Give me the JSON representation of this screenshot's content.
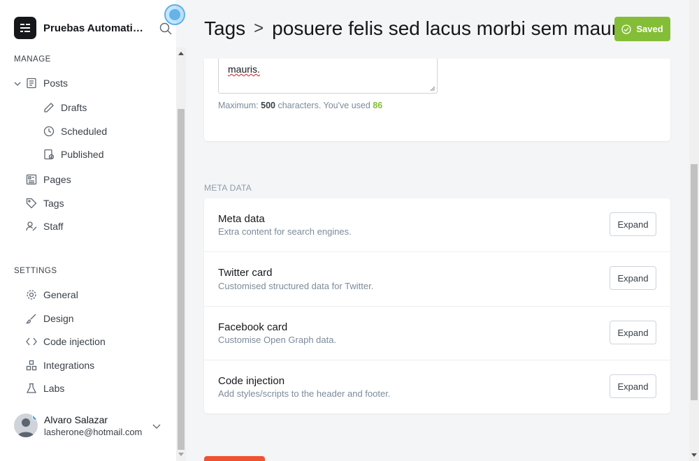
{
  "sidebar": {
    "brand_name": "Pruebas Automatizadas",
    "manage_title": "MANAGE",
    "settings_title": "SETTINGS",
    "items": {
      "posts": "Posts",
      "drafts": "Drafts",
      "scheduled": "Scheduled",
      "published": "Published",
      "pages": "Pages",
      "tags": "Tags",
      "staff": "Staff",
      "general": "General",
      "design": "Design",
      "code_injection": "Code injection",
      "integrations": "Integrations",
      "labs": "Labs"
    },
    "user": {
      "name": "Alvaro Salazar",
      "email": "lasherone@hotmail.com"
    }
  },
  "header": {
    "crumb_root": "Tags",
    "crumb_sep": ">",
    "crumb_current": "posuere felis sed lacus morbi sem mauris",
    "saved_label": "Saved"
  },
  "description": {
    "visible_text": "mauris.",
    "counter_prefix": "Maximum: ",
    "max": "500",
    "counter_mid": " characters. You've used ",
    "used": "86"
  },
  "meta": {
    "section_label": "META DATA",
    "rows": [
      {
        "title": "Meta data",
        "desc": "Extra content for search engines.",
        "button": "Expand"
      },
      {
        "title": "Twitter card",
        "desc": "Customised structured data for Twitter.",
        "button": "Expand"
      },
      {
        "title": "Facebook card",
        "desc": "Customise Open Graph data.",
        "button": "Expand"
      },
      {
        "title": "Code injection",
        "desc": "Add styles/scripts to the header and footer.",
        "button": "Expand"
      }
    ]
  },
  "colors": {
    "accent_green": "#84bd37",
    "delete_red": "#f05230",
    "sidebar_bg": "#ffffff",
    "main_bg": "#f4f5f6"
  },
  "icons": {
    "brand": "ghost-logo-icon",
    "search": "search-icon",
    "posts": "document-icon",
    "drafts": "pencil-icon",
    "scheduled": "clock-icon",
    "published": "published-icon",
    "pages": "pages-icon",
    "tags": "tag-icon",
    "staff": "staff-icon",
    "general": "gear-icon",
    "design": "brush-icon",
    "code_injection": "code-icon",
    "integrations": "integrations-icon",
    "labs": "flask-icon",
    "saved": "check-circle-icon"
  }
}
